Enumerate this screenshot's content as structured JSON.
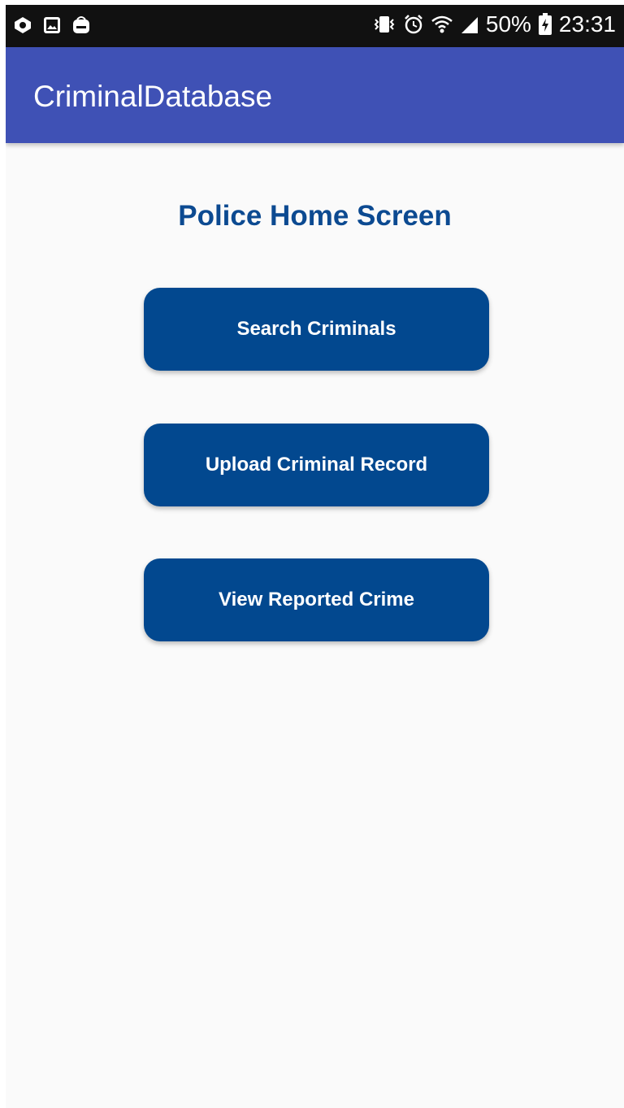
{
  "status_bar": {
    "left_icons": [
      "photo-sphere-icon",
      "gallery-icon",
      "bag-icon"
    ],
    "right_icons": [
      "vibrate-icon",
      "alarm-icon",
      "wifi-icon",
      "signal-icon",
      "battery-charging-icon"
    ],
    "battery": "50%",
    "time": "23:31"
  },
  "app_bar": {
    "title": "CriminalDatabase",
    "color": "#3f51b5"
  },
  "main": {
    "heading": "Police Home Screen",
    "buttons": [
      {
        "label": "Search Criminals"
      },
      {
        "label": "Upload Criminal Record"
      },
      {
        "label": "View Reported Crime"
      }
    ],
    "accent_color": "#02488f"
  }
}
